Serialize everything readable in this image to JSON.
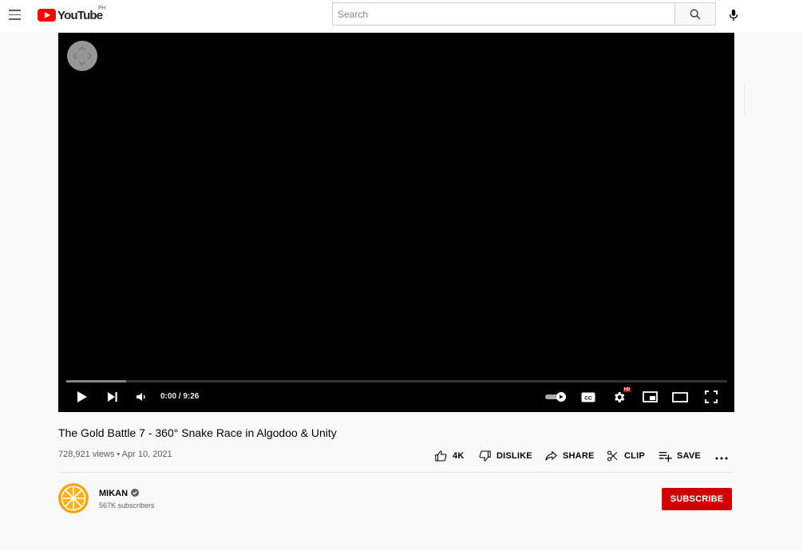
{
  "header": {
    "logo_text": "YouTube",
    "country_code": "PH",
    "search_placeholder": "Search"
  },
  "player": {
    "time_display": "0:00 / 9:26",
    "hd_badge": "HD",
    "progress_loaded_fraction": 0.09
  },
  "video": {
    "title": "The Gold Battle 7 - 360° Snake Race in Algodoo & Unity",
    "meta": "728,921 views • Apr 10, 2021"
  },
  "actions": {
    "like_label": "4K",
    "dislike_label": "DISLIKE",
    "share_label": "SHARE",
    "clip_label": "CLIP",
    "save_label": "SAVE"
  },
  "channel": {
    "name": "MIKAN",
    "subscribers": "567K subscribers",
    "subscribe_label": "SUBSCRIBE"
  },
  "colors": {
    "brand_red": "#ff0000",
    "subscribe_red": "#cc0000"
  },
  "icons": [
    "menu-icon",
    "youtube-logo-icon",
    "search-icon",
    "mic-icon",
    "360-nav-icon",
    "play-icon",
    "next-icon",
    "volume-icon",
    "autoplay-toggle-icon",
    "captions-icon",
    "settings-icon",
    "miniplayer-icon",
    "theater-icon",
    "fullscreen-icon",
    "like-icon",
    "dislike-icon",
    "share-icon",
    "clip-icon",
    "save-icon",
    "more-icon",
    "verified-icon"
  ]
}
